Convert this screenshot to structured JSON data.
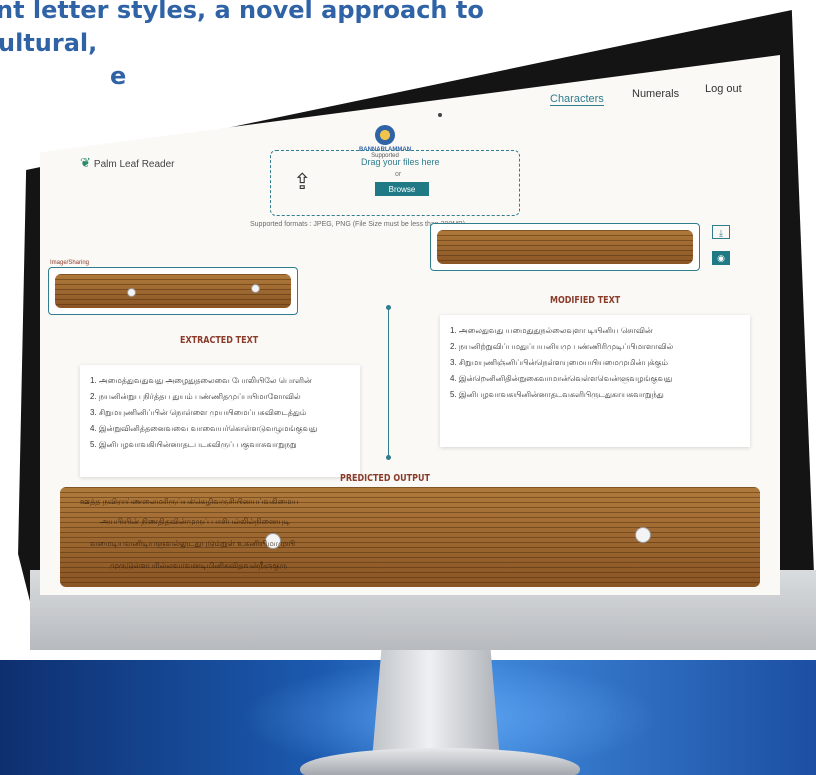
{
  "brochure": {
    "line1": "nt letter styles, a novel approach to",
    "line2": "ultural,",
    "line3": "e"
  },
  "app": {
    "brand": "Palm Leaf Reader",
    "logo_title": "BANNARI AMMAN",
    "logo_sub": "Supported"
  },
  "nav": {
    "characters": "Characters",
    "numerals": "Numerals",
    "logout": "Log out"
  },
  "upload": {
    "drag_text": "Drag your files here",
    "or_text": "or",
    "browse_label": "Browse",
    "formats": "Supported formats : JPEG, PNG (File Size must be less than 200MB)"
  },
  "sections": {
    "extracted": "EXTRACTED TEXT",
    "modified": "MODIFIED TEXT",
    "predicted": "PREDICTED OUTPUT",
    "small_label": "Image/Sharing"
  },
  "extracted_lines": [
    "1. அமைத்துவதுவது அழைதுதலைவை போலியிலே பொளின்",
    "2. நயனின்றுப நிர்த்தப துயம் பண்ணிதமுப்பயிமாளோவில்",
    "3. சிறுமயுணினிப்பின் நொள்ளை முயயிமைப்பசுவிடைத்தும்",
    "4. இன்றுவினித்தனைவவை வாவையர்கொள்ளடுவழுமங்குவது",
    "5. இனிபழவாவகியின்னாதடபடகவிருப் பகுவாசுவாறுநறு"
  ],
  "modified_lines": [
    "1. அலைதுவது யமைதுதுநல்லைவுளா டியினிய சொவின்",
    "2. நயனிற்றுவிப்பமதுப்பயனியமு பண்ணிரிமுடிப்பிமாளாவில்",
    "3. சிறுமயுணிஞ்னிப்பின்நெள்ளயுமையயியமைமுமின்புக்கும்",
    "4. இன்றெனினிதின்றுகைவாமான்வெள்ளவென்ளுவழங்குவது",
    "5. இனிபழவாவகயினின்னாதடவகளிபிருடதுகாயகவாறுந்து"
  ],
  "predicted_lines": [
    "ஊத்த நவிராய்ணலைமரிருப்யக்கெழிவருசியினயப்வகிமைய",
    "அயபியின் நிணதிதவின்முருப் பாசிபல்லில்நினையுடி",
    "வமைடியவனிடியளுவல்லுடதுபுடும்றுள் உகனியிமாமுயி",
    "முருடுள்ளபரில்லவாவனடிமினிகவிதவன்நீஞகுரு"
  ],
  "colors": {
    "accent": "#2f7d8f",
    "heading": "#8a3b2a",
    "brochure_text": "#2f63a6"
  }
}
